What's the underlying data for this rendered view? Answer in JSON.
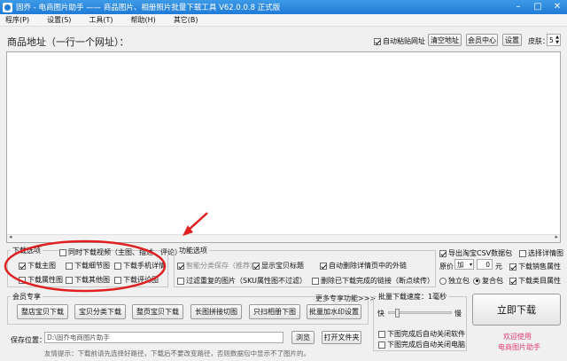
{
  "window": {
    "title": "固乔 - 电商图片助手 —— 商品图片、相册照片批量下载工具 V62.0.0.8 正式版"
  },
  "menu": [
    "程序(P)",
    "设置(S)",
    "工具(T)",
    "帮助(H)",
    "其它(B)"
  ],
  "header": {
    "url_label": "商品地址（一行一个网址）：",
    "auto_paste_label": "自动粘贴网址",
    "auto_paste_checked": true,
    "clear_button": "清空地址",
    "member_button": "会员中心",
    "settings_button": "设置",
    "skin_label": "皮肤：",
    "skin_value": "5"
  },
  "url_textarea_value": "",
  "download_options": {
    "title": "下载选项",
    "video_option": {
      "label": "同时下载视频（主图、描述、评论）",
      "checked": false
    },
    "items": [
      {
        "label": "下载主图",
        "checked": true
      },
      {
        "label": "下载细节图",
        "checked": false
      },
      {
        "label": "下载手机详情",
        "checked": false
      },
      {
        "label": "下载属性图",
        "checked": false
      },
      {
        "label": "下载其他图",
        "checked": false
      },
      {
        "label": "下载评论图",
        "checked": false
      }
    ]
  },
  "feature_options": {
    "title": "功能选项",
    "smart_category": {
      "label": "智能分类保存（推荐）",
      "checked": true,
      "disabled": true
    },
    "show_title": {
      "label": "显示宝贝标题",
      "checked": true
    },
    "auto_delete_outer": {
      "label": "自动删除详情页中的外链",
      "checked": true
    },
    "filter_duplicate": {
      "label": "过滤重复的图片（SKU属性图不过滤）",
      "checked": false
    },
    "delete_downloaded": {
      "label": "删除已下载完成的链接（断点续传）",
      "checked": false
    }
  },
  "csv_options": {
    "export_csv": {
      "label": "导出淘宝CSV数据包",
      "checked": true
    },
    "selective_details": {
      "label": "选择详情图",
      "checked": false
    },
    "price_label": "原价",
    "price_op": "加",
    "price_value": "0",
    "price_unit": "元",
    "sales_attr": {
      "label": "下载销售属性",
      "checked": true
    },
    "standalone": {
      "label": "独立包",
      "selected": false
    },
    "merged": {
      "label": "复合包",
      "selected": true
    },
    "category_attr": {
      "label": "下载类目属性",
      "checked": true
    }
  },
  "member": {
    "title": "会员专享",
    "more_label": "更多专享功能>>>",
    "buttons": [
      "整店宝贝下载",
      "宝贝分类下载",
      "整页宝贝下载",
      "长图拼接切图",
      "只扫相册下图",
      "批量加水印设置"
    ]
  },
  "batch": {
    "speed_label": "批量下载速度：1毫秒",
    "fast_label": "快",
    "slow_label": "慢",
    "speed_level": 0.1,
    "close_app": {
      "label": "下图完成后自动关闭软件",
      "checked": false
    },
    "shutdown": {
      "label": "下图完成后自动关闭电脑",
      "checked": false
    }
  },
  "download_button": "立即下载",
  "welcome": [
    "欢迎使用",
    "电商图片助手"
  ],
  "save": {
    "label": "保存位置：",
    "path": "D:\\固乔电商图片助手",
    "browse_button": "浏览",
    "open_button": "打开文件夹"
  },
  "tip": "友情提示：下载前请先选择好路径，下载后不要改变路径，否则数据包中显示不了图片的。",
  "colors": {
    "titlebar": "#1f7bd6",
    "annotation_red": "#e02020",
    "welcome_pink": "#e0407a"
  }
}
